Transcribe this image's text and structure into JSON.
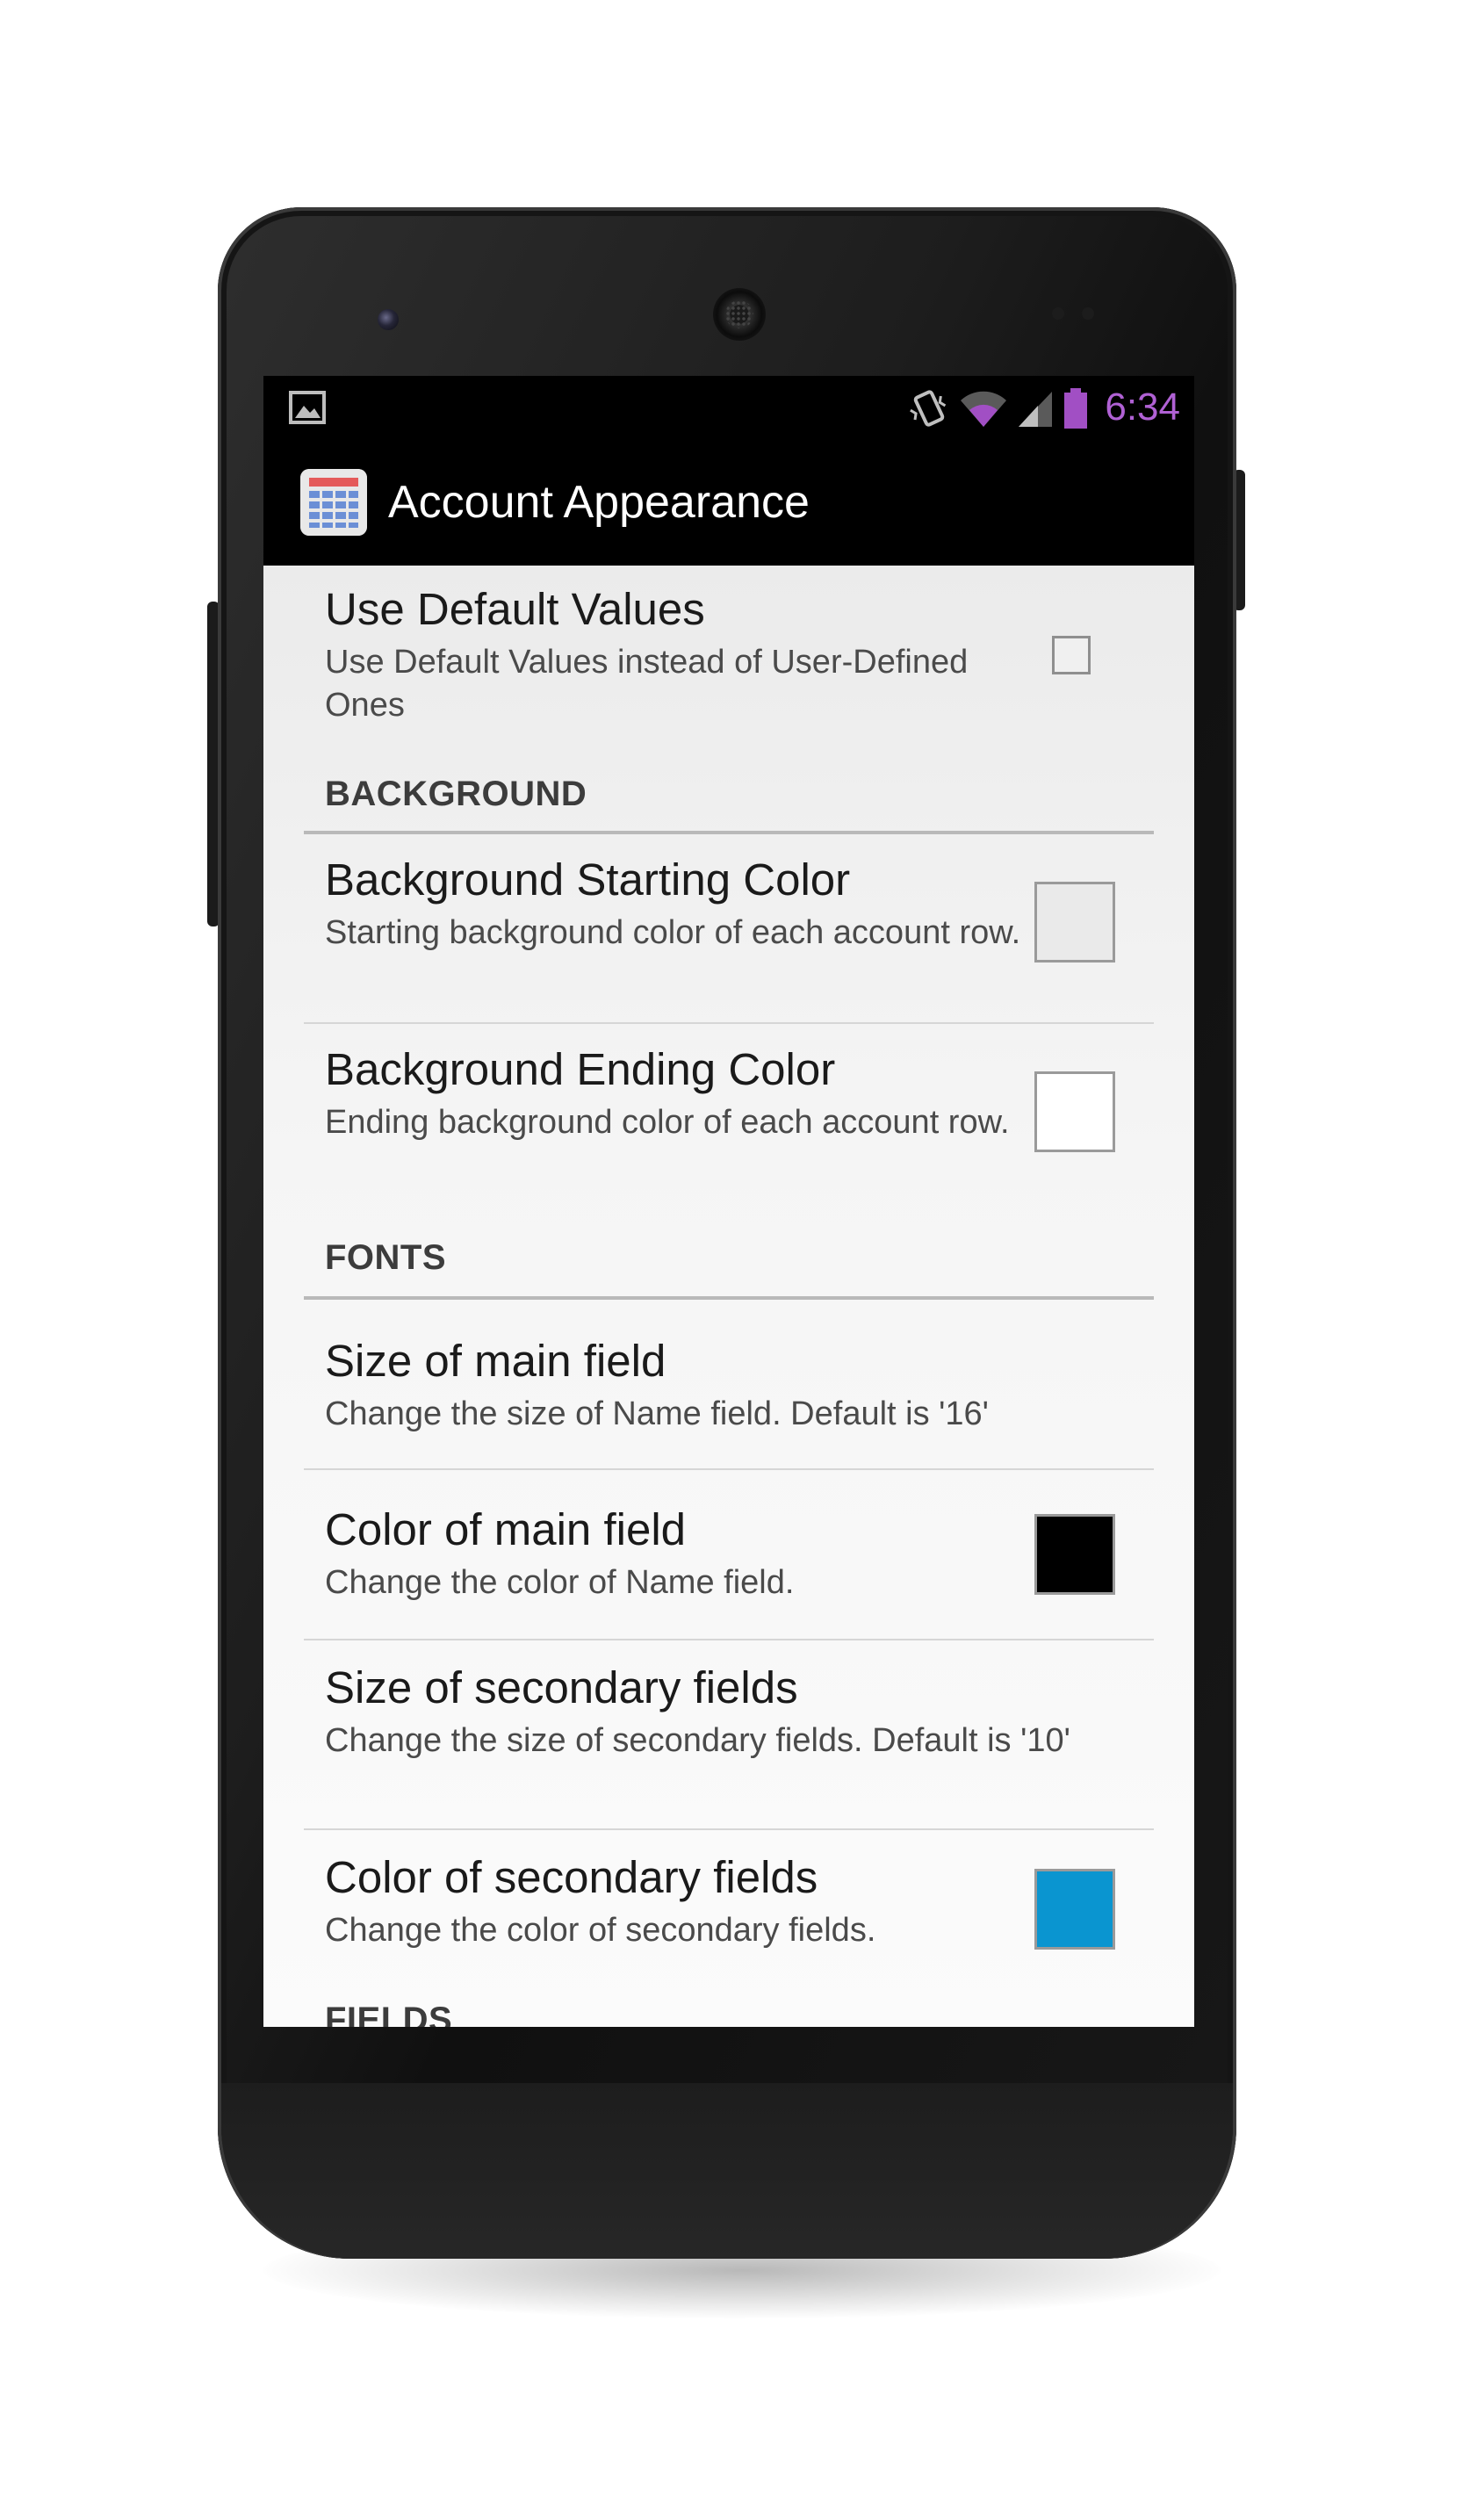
{
  "status_bar": {
    "time": "6:34",
    "icons": [
      "gallery-notification-icon",
      "vibrate-icon",
      "wifi-icon",
      "cell-signal-icon",
      "battery-icon"
    ],
    "clock_color": "#b061d4"
  },
  "action_bar": {
    "app_icon": "calculator-grid-icon",
    "title": "Account Appearance"
  },
  "preferences": {
    "use_default": {
      "title": "Use Default Values",
      "summary": "Use Default Values instead of User-Defined Ones",
      "checked": false
    },
    "background_category": "BACKGROUND",
    "bg_start": {
      "title": "Background Starting Color",
      "summary": "Starting background color of each account row.",
      "color": "#eaeaea"
    },
    "bg_end": {
      "title": "Background Ending Color",
      "summary": "Ending background color of each account row.",
      "color": "#ffffff"
    },
    "fonts_category": "FONTS",
    "main_size": {
      "title": "Size of main field",
      "summary": "Change the size of Name field. Default is '16'"
    },
    "main_color": {
      "title": "Color of main field",
      "summary": "Change the color of Name field.",
      "color": "#000000"
    },
    "secondary_size": {
      "title": "Size of secondary fields",
      "summary": "Change the size of secondary fields. Default is '10'"
    },
    "secondary_color": {
      "title": "Color of secondary fields",
      "summary": "Change the color of secondary fields.",
      "color": "#0a95d0"
    },
    "fields_category": "FIELDS"
  }
}
